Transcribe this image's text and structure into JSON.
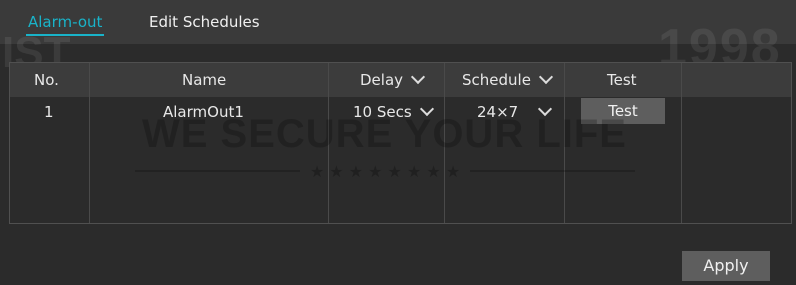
{
  "tabs": [
    {
      "label": "Alarm-out",
      "active": true
    },
    {
      "label": "Edit Schedules",
      "active": false
    }
  ],
  "watermark": {
    "year": "1998",
    "brand_fragment": "IST",
    "slogan": "WE SECURE YOUR LIFE",
    "stars": "★ ★ ★ ★ ★ ★ ★ ★"
  },
  "table": {
    "columns": {
      "no": "No.",
      "name": "Name",
      "delay": "Delay",
      "schedule": "Schedule",
      "test": "Test"
    },
    "rows": [
      {
        "no": "1",
        "name": "AlarmOut1",
        "delay": "10 Secs",
        "schedule": "24×7",
        "test_label": "Test"
      }
    ]
  },
  "apply_label": "Apply",
  "colors": {
    "accent": "#19b3c9",
    "background": "#2b2b2b",
    "button": "#5e5e5e"
  }
}
